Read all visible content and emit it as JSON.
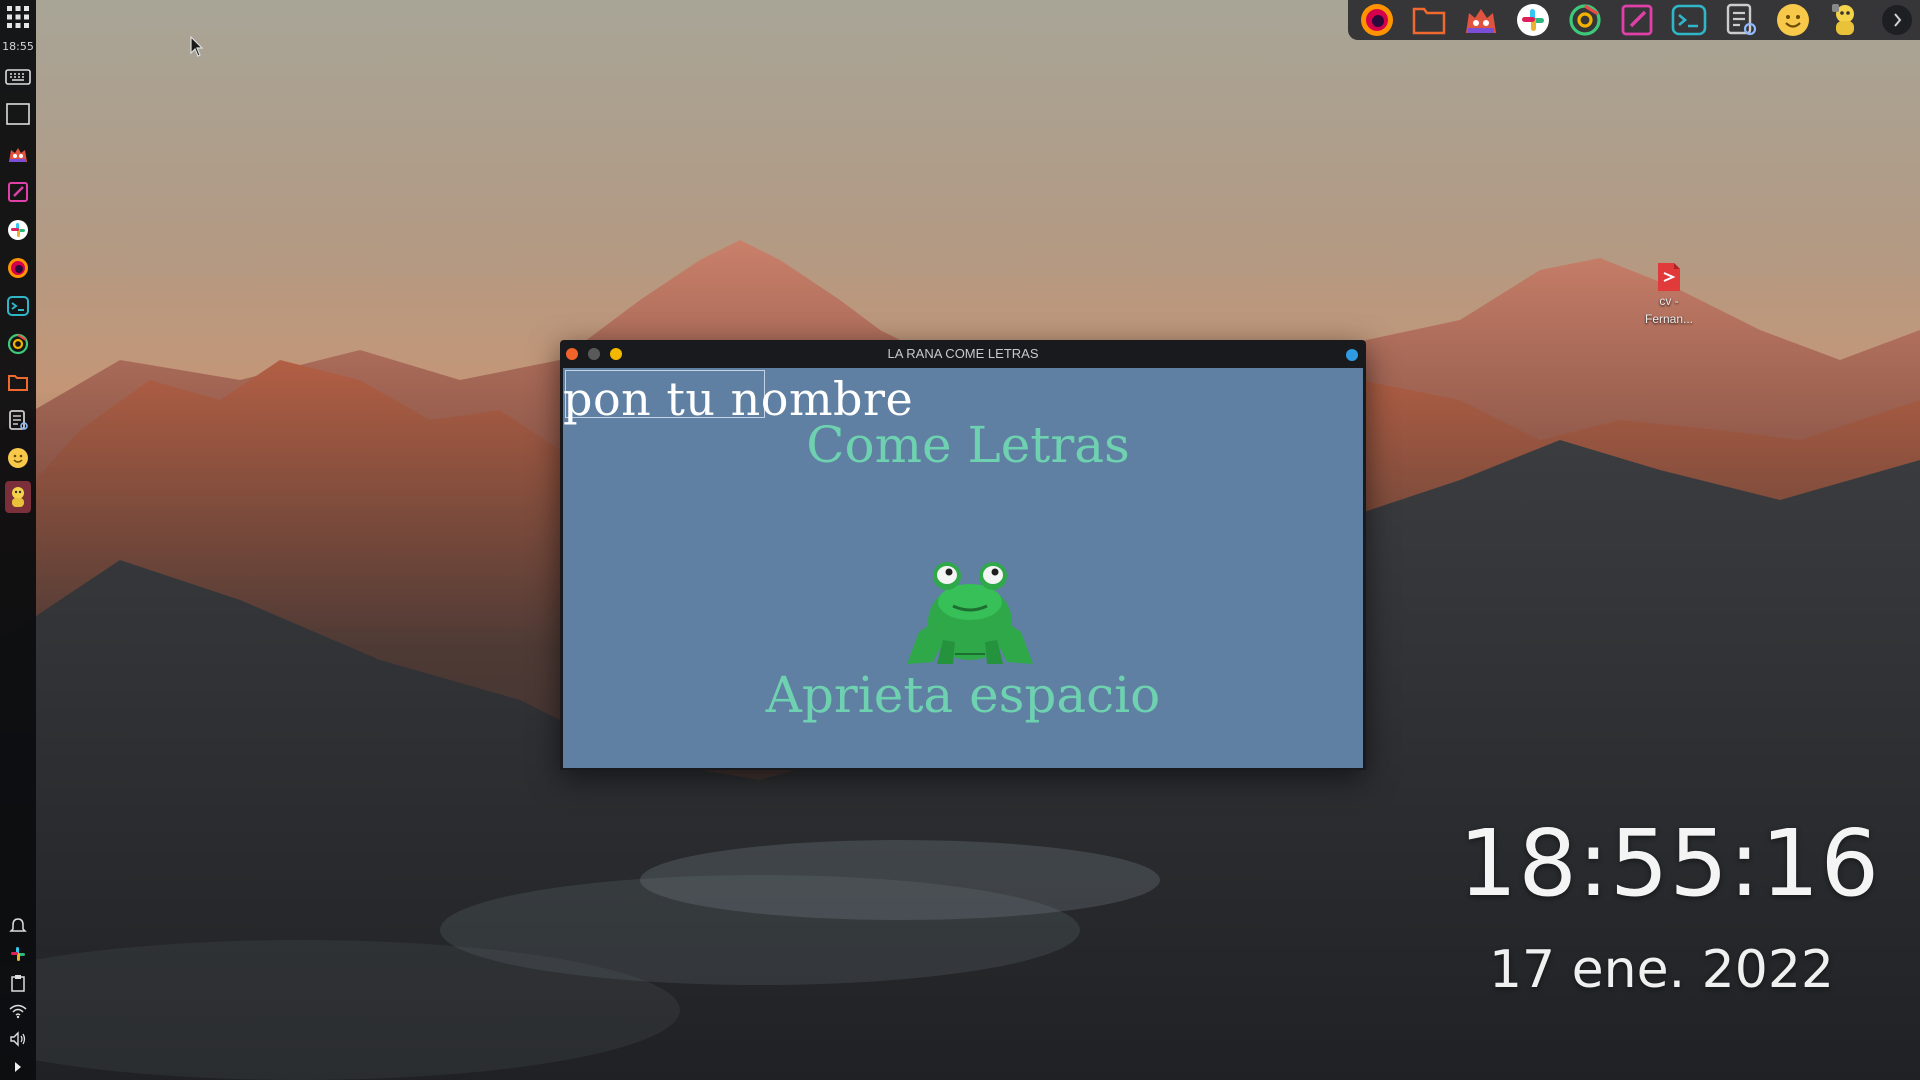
{
  "left_panel": {
    "clock": "18:55",
    "launchers": [
      {
        "icon": "app-grid-icon"
      },
      {
        "icon": "keyboard-icon"
      },
      {
        "icon": "screen-icon"
      },
      {
        "icon": "gitkraken-icon"
      },
      {
        "icon": "text-editor-icon"
      },
      {
        "icon": "slack-icon"
      },
      {
        "icon": "firefox-icon"
      },
      {
        "icon": "terminal-icon"
      },
      {
        "icon": "chrome-icon"
      },
      {
        "icon": "files-icon"
      },
      {
        "icon": "notes-icon"
      },
      {
        "icon": "emoji-icon"
      },
      {
        "icon": "mascot-app-icon"
      }
    ],
    "tray": [
      {
        "icon": "notifications-icon"
      },
      {
        "icon": "slack-tray-icon"
      },
      {
        "icon": "clipboard-icon"
      },
      {
        "icon": "wifi-icon"
      },
      {
        "icon": "volume-icon"
      },
      {
        "icon": "expand-arrow-icon"
      }
    ]
  },
  "top_dock": {
    "items": [
      {
        "icon": "firefox-icon"
      },
      {
        "icon": "files-icon"
      },
      {
        "icon": "gitkraken-icon"
      },
      {
        "icon": "slack-icon"
      },
      {
        "icon": "chrome-icon"
      },
      {
        "icon": "text-editor-icon"
      },
      {
        "icon": "terminal-icon"
      },
      {
        "icon": "notes-icon"
      },
      {
        "icon": "emoji-icon"
      },
      {
        "icon": "mascot-app-icon"
      },
      {
        "icon": "night-mode-icon"
      }
    ]
  },
  "desktop_file": {
    "label": "cv -\nFernan...",
    "icon": "pdf-file-icon"
  },
  "window": {
    "title": "LA RANA COME LETRAS",
    "name_input": "pon tu nombre",
    "game_title": "Come Letras",
    "prompt": "Aprieta espacio"
  },
  "desktop_clock": {
    "time": "18:55:16",
    "date": "17 ene. 2022"
  },
  "colors": {
    "game_background": "#5f80a3",
    "game_text": "#6ed2b0",
    "frog_green": "#2fa84a",
    "close_dot": "#f0642c",
    "min_dot": "#5a5a5a",
    "max_dot": "#f5b800",
    "window_badge": "#2f9be0"
  }
}
